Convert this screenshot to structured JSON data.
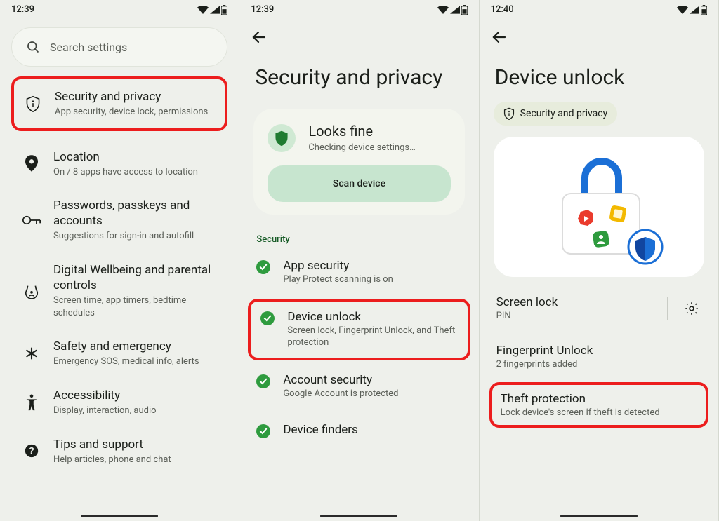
{
  "phone1": {
    "time": "12:39",
    "search_placeholder": "Search settings",
    "items": [
      {
        "title": "Security and privacy",
        "sub": "App security, device lock, permissions",
        "icon": "privacy-tip-icon",
        "highlighted": true
      },
      {
        "title": "Location",
        "sub": "On / 8 apps have access to location",
        "icon": "location-icon"
      },
      {
        "title": "Passwords, passkeys and accounts",
        "sub": "Suggestions for sign-in and autofill",
        "icon": "key-icon"
      },
      {
        "title": "Digital Wellbeing and parental controls",
        "sub": "Screen time, app timers, bedtime schedules",
        "icon": "wellbeing-icon"
      },
      {
        "title": "Safety and emergency",
        "sub": "Emergency SOS, medical info, alerts",
        "icon": "asterisk-icon"
      },
      {
        "title": "Accessibility",
        "sub": "Display, interaction, audio",
        "icon": "accessibility-icon"
      },
      {
        "title": "Tips and support",
        "sub": "Help articles, phone and chat",
        "icon": "help-icon"
      }
    ]
  },
  "phone2": {
    "time": "12:39",
    "title": "Security and privacy",
    "card": {
      "title": "Looks fine",
      "sub": "Checking device settings…",
      "button": "Scan device"
    },
    "section_label": "Security",
    "items": [
      {
        "title": "App security",
        "sub": "Play Protect scanning is on"
      },
      {
        "title": "Device unlock",
        "sub": "Screen lock, Fingerprint Unlock, and Theft protection",
        "highlighted": true
      },
      {
        "title": "Account security",
        "sub": "Google Account is protected"
      },
      {
        "title": "Device finders",
        "sub": ""
      }
    ]
  },
  "phone3": {
    "time": "12:40",
    "title": "Device unlock",
    "breadcrumb": "Security and privacy",
    "items": [
      {
        "title": "Screen lock",
        "sub": "PIN",
        "has_gear": true
      },
      {
        "title": "Fingerprint Unlock",
        "sub": "2 fingerprints added"
      },
      {
        "title": "Theft protection",
        "sub": "Lock device's screen if theft is detected",
        "highlighted": true
      }
    ]
  }
}
